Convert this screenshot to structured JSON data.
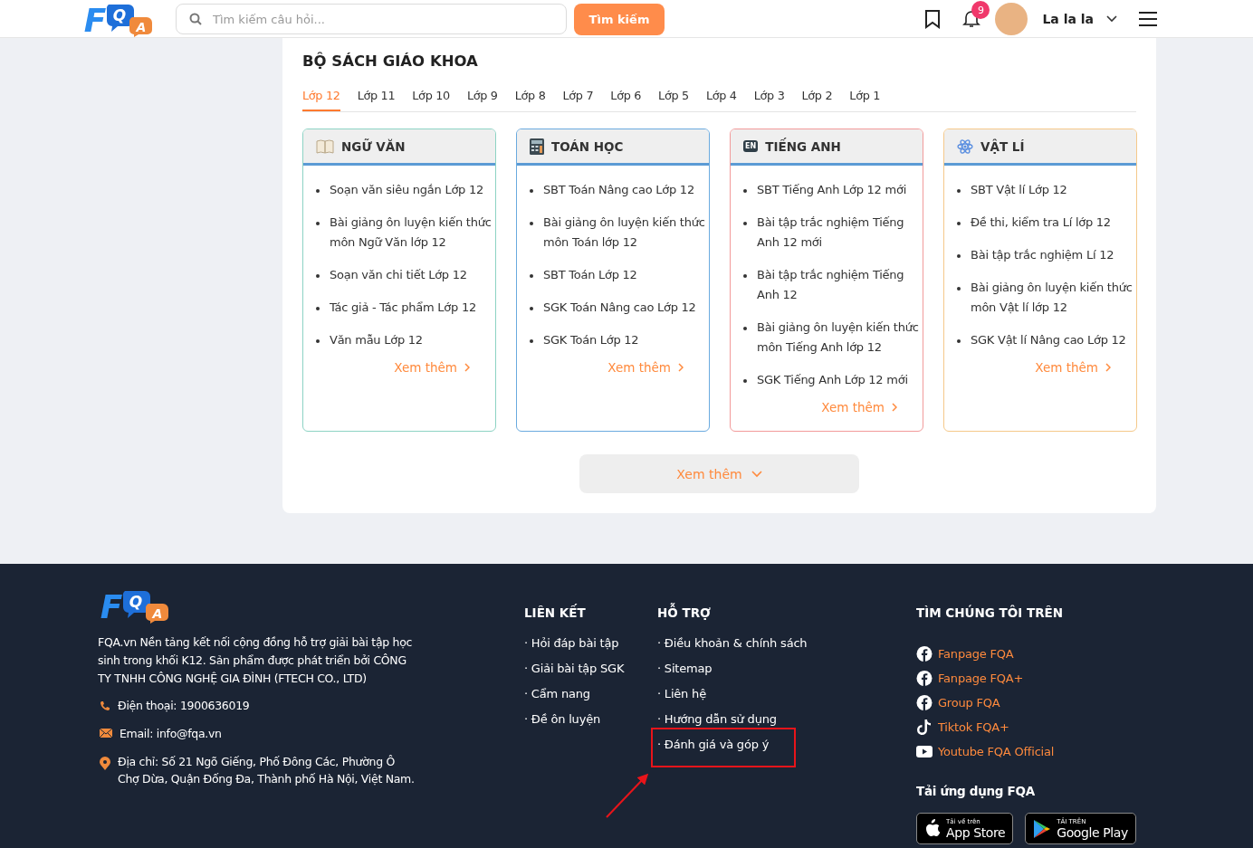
{
  "header": {
    "logo": [
      "F",
      "Q",
      "A"
    ],
    "search": {
      "placeholder": "Tìm kiếm câu hỏi..."
    },
    "search_button": "Tìm kiếm",
    "notifications": "9",
    "user": "La la la"
  },
  "books": {
    "title": "BỘ SÁCH GIÁO KHOA",
    "tabs": [
      {
        "label": "Lớp 12",
        "selected": true
      },
      {
        "label": "Lớp 11",
        "selected": false
      },
      {
        "label": "Lớp 10",
        "selected": false
      },
      {
        "label": "Lớp 9",
        "selected": false
      },
      {
        "label": "Lớp 8",
        "selected": false
      },
      {
        "label": "Lớp 7",
        "selected": false
      },
      {
        "label": "Lớp 6",
        "selected": false
      },
      {
        "label": "Lớp 5",
        "selected": false
      },
      {
        "label": "Lớp 4",
        "selected": false
      },
      {
        "label": "Lớp 3",
        "selected": false
      },
      {
        "label": "Lớp 2",
        "selected": false
      },
      {
        "label": "Lớp 1",
        "selected": false
      }
    ],
    "subjects": [
      {
        "title": "NGỮ VĂN",
        "kind": "book",
        "color": "#8dd3c4",
        "items": [
          "Soạn văn siêu ngắn Lớp 12",
          "Bài giảng ôn luyện kiến thức môn Ngữ Văn lớp 12",
          "Soạn văn chi tiết Lớp 12",
          "Tác giả - Tác phẩm Lớp 12",
          "Văn mẫu Lớp 12"
        ],
        "more": "Xem thêm"
      },
      {
        "title": "TOÁN HỌC",
        "kind": "calculator",
        "color": "#6aaadf",
        "items": [
          "SBT Toán Nâng cao Lớp 12",
          "Bài giảng ôn luyện kiến thức môn Toán lớp 12",
          "SBT Toán Lớp 12",
          "SGK Toán Nâng cao Lớp 12",
          "SGK Toán Lớp 12"
        ],
        "more": "Xem thêm"
      },
      {
        "title": "TIẾNG ANH",
        "kind": "badge",
        "badge": "EN",
        "color": "#f29a9a",
        "items": [
          "SBT Tiếng Anh Lớp 12 mới",
          "Bài tập trắc nghiệm Tiếng Anh 12 mới",
          "Bài tập trắc nghiệm Tiếng Anh 12",
          "Bài giảng ôn luyện kiến thức môn Tiếng Anh lớp 12",
          "SGK Tiếng Anh Lớp 12 mới"
        ],
        "more": "Xem thêm"
      },
      {
        "title": "VẬT LÍ",
        "kind": "atom",
        "color": "#f5c98a",
        "items": [
          "SBT Vật lí Lớp 12",
          "Đề thi, kiểm tra Lí lớp 12",
          "Bài tập trắc nghiệm Lí 12",
          "Bài giảng ôn luyện kiến thức môn Vật lí lớp 12",
          "SGK Vật lí Nâng cao Lớp 12"
        ],
        "more": "Xem thêm"
      }
    ],
    "more_button": "Xem thêm"
  },
  "footer": {
    "logo": [
      "F",
      "Q",
      "A"
    ],
    "description": "FQA.vn Nền tảng kết nối cộng đồng hỗ trợ giải bài tập học sinh trong khối K12. Sản phẩm được phát triển bởi CÔNG TY TNHH CÔNG NGHỆ GIA ĐÌNH (FTECH CO., LTD)",
    "contacts": [
      {
        "kind": "phone",
        "text": "Điện thoại: 1900636019"
      },
      {
        "kind": "email",
        "text": "Email: info@fqa.vn"
      },
      {
        "kind": "address",
        "text": "Địa chỉ: Số 21 Ngõ Giếng, Phố Đông Các, Phường Ô Chợ Dừa, Quận Đống Đa, Thành phố Hà Nội, Việt Nam."
      }
    ],
    "links": {
      "title": "LIÊN KẾT",
      "items": [
        {
          "label": "· Hỏi đáp bài tập",
          "highlighted": false
        },
        {
          "label": "· Giải bài tập SGK",
          "highlighted": false
        },
        {
          "label": "· Cẩm nang",
          "highlighted": false
        },
        {
          "label": "· Đề ôn luyện",
          "highlighted": false
        }
      ]
    },
    "support": {
      "title": "HỖ TRỢ",
      "items": [
        {
          "label": "· Điều khoản & chính sách",
          "highlighted": false
        },
        {
          "label": "· Sitemap",
          "highlighted": false
        },
        {
          "label": "· Liên hệ",
          "highlighted": false
        },
        {
          "label": "· Hướng dẫn sử dụng",
          "highlighted": false
        },
        {
          "label": "· Đánh giá và góp ý",
          "highlighted": true
        }
      ]
    },
    "social": {
      "title": "TÌM CHÚNG TÔI TRÊN",
      "items": [
        {
          "kind": "facebook",
          "label": "Fanpage FQA"
        },
        {
          "kind": "facebook",
          "label": "Fanpage FQA+"
        },
        {
          "kind": "facebook",
          "label": "Group FQA"
        },
        {
          "kind": "tiktok",
          "label": "Tiktok FQA+"
        },
        {
          "kind": "youtube",
          "label": "Youtube FQA Official"
        }
      ]
    },
    "app_title": "Tải ứng dụng FQA",
    "stores": [
      {
        "kind": "apple",
        "small": "Tải về trên",
        "big": "App Store"
      },
      {
        "kind": "google",
        "small": "TẢI TRÊN",
        "big": "Google Play"
      }
    ]
  }
}
